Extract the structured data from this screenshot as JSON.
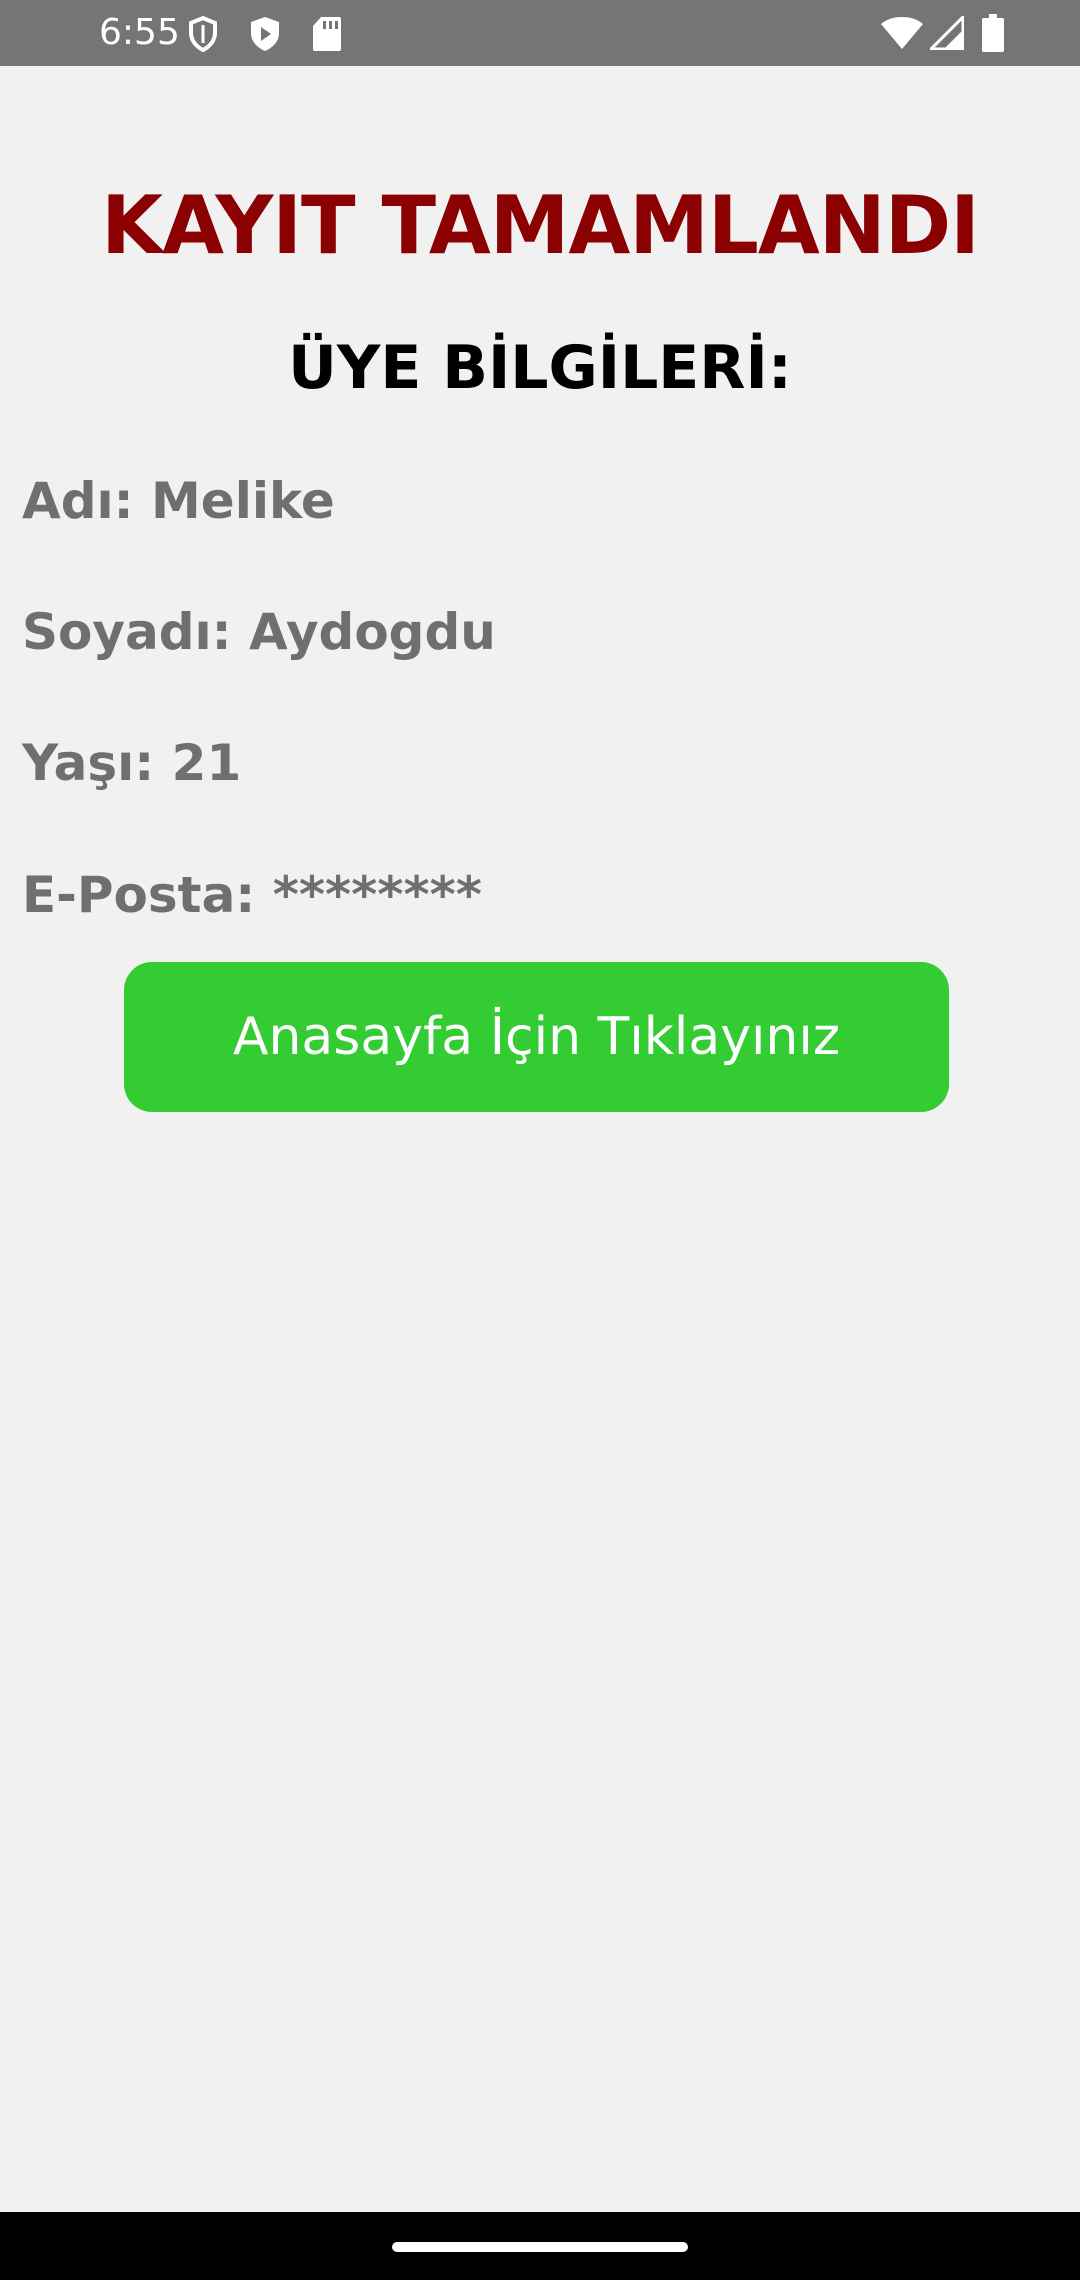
{
  "status_bar": {
    "time": "6:55",
    "left_icons": [
      "shield-icon",
      "play-store-icon",
      "sd-card-icon"
    ],
    "right_icons": [
      "wifi-icon",
      "cell-signal-icon",
      "battery-icon"
    ]
  },
  "screen": {
    "title": "KAYIT TAMAMLANDI",
    "subtitle": "ÜYE BİLGİLERİ:",
    "fields": {
      "name": "Adı: Melike",
      "surname": "Soyadı: Aydogdu",
      "age": "Yaşı: 21",
      "email": "E-Posta: ********"
    },
    "home_button_label": "Anasayfa İçin Tıklayınız"
  },
  "colors": {
    "status_bar": "#757575",
    "background": "#f1f1f1",
    "title": "#8b0000",
    "field_text": "#6f6f6f",
    "button": "#33cc33",
    "button_text": "#ffffff",
    "nav_bar": "#000000"
  }
}
